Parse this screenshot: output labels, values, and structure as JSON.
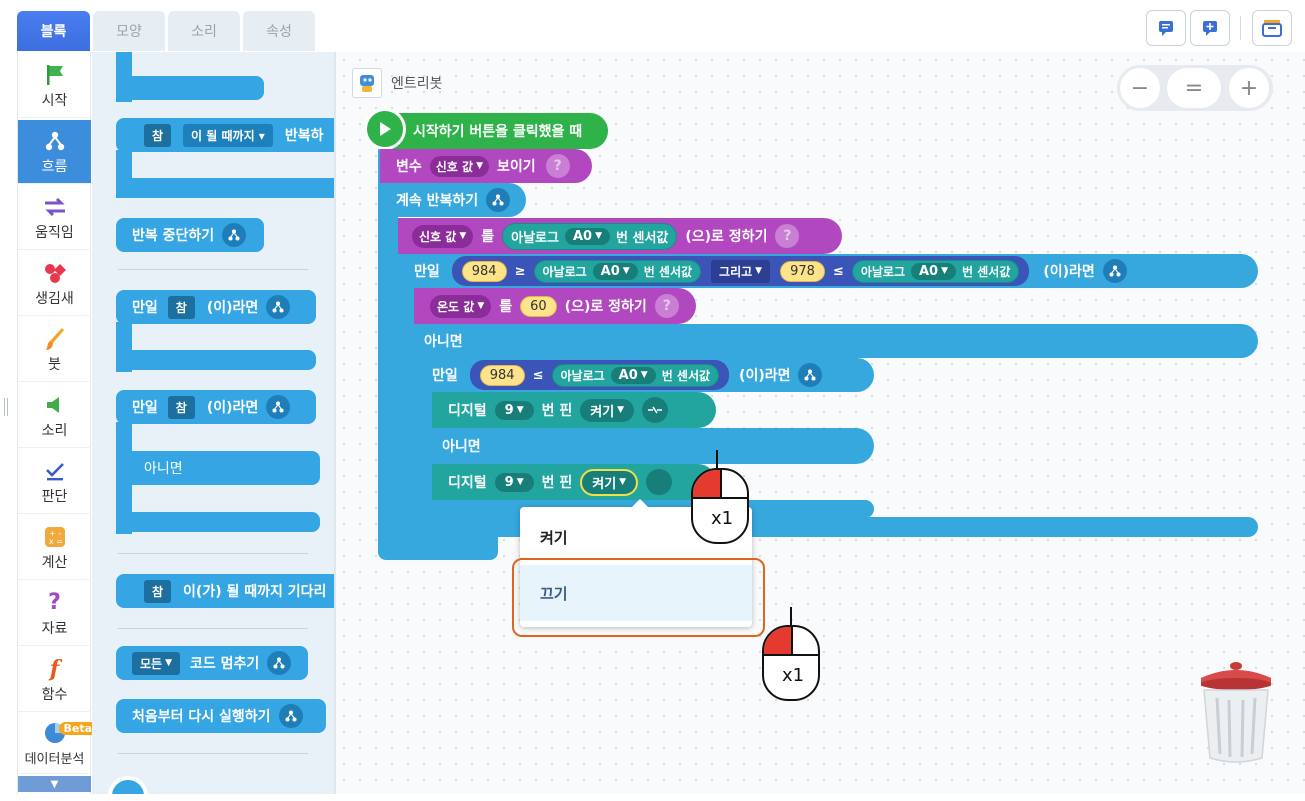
{
  "tabs": [
    "블록",
    "모양",
    "소리",
    "속성"
  ],
  "categories": [
    "시작",
    "흐름",
    "움직임",
    "생김새",
    "붓",
    "소리",
    "판단",
    "계산",
    "자료",
    "함수",
    "데이터분석"
  ],
  "beta_badge": "Beta",
  "palette": {
    "repeat_until": {
      "cond": "참",
      "label": "이 될 때까지 ▾",
      "suffix": "반복하"
    },
    "break": "반복 중단하기",
    "if1": {
      "kw": "만일",
      "cond": "참",
      "suffix": "(이)라면"
    },
    "if2": {
      "kw": "만일",
      "cond": "참",
      "suffix": "(이)라면",
      "else": "아니면"
    },
    "wait_until": {
      "cond": "참",
      "suffix": "이(가) 될 때까지 기다리"
    },
    "stop": {
      "dd": "모든",
      "suffix": "코드 멈추기"
    },
    "restart": "처음부터 다시 실행하기"
  },
  "object_name": "엔트리봇",
  "zoom": {
    "minus": "−",
    "reset": "=",
    "plus": "+"
  },
  "script": {
    "start": "시작하기 버튼을 클릭했을 때",
    "show_var": {
      "kw": "변수",
      "var": "신호 값",
      "suffix": "보이기"
    },
    "forever": "계속 반복하기",
    "set1": {
      "var": "신호 값",
      "kw": "를",
      "sensor": "아날로그",
      "port": "A0",
      "sensor_suffix": "번 센서값",
      "suffix": "(으)로 정하기"
    },
    "if_outer": {
      "kw": "만일",
      "n1": "984",
      "op1": "≥",
      "sensor": "아날로그",
      "port": "A0",
      "sensor_suffix": "번 센서값",
      "and": "그리고",
      "n2": "978",
      "op2": "≤",
      "suffix": "(이)라면"
    },
    "set2": {
      "var": "온도 값",
      "kw": "를",
      "value": "60",
      "suffix": "(으)로 정하기"
    },
    "else_outer": "아니면",
    "if_inner": {
      "kw": "만일",
      "n1": "984",
      "op1": "≤",
      "sensor": "아날로그",
      "port": "A0",
      "sensor_suffix": "번 센서값",
      "suffix": "(이)라면"
    },
    "digital1": {
      "kw": "디지털",
      "pin": "9",
      "mid": "번 핀",
      "state": "켜기"
    },
    "else_inner": "아니면",
    "digital2": {
      "kw": "디지털",
      "pin": "9",
      "mid": "번 핀",
      "state": "켜기"
    }
  },
  "dropdown": {
    "opt1": "켜기",
    "opt2": "끄기"
  },
  "mouse_hint1": "x1",
  "mouse_hint2": "x1"
}
